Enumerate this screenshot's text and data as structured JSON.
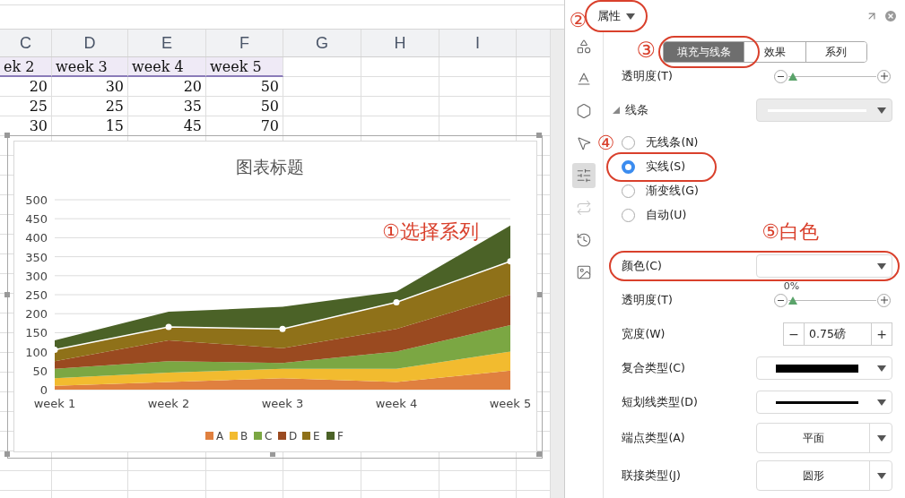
{
  "sheet": {
    "columns": [
      {
        "label": "C"
      },
      {
        "label": "D"
      },
      {
        "label": "E"
      },
      {
        "label": "F"
      },
      {
        "label": "G"
      },
      {
        "label": "H"
      },
      {
        "label": "I"
      }
    ],
    "rows": [
      {
        "kind": "text",
        "selected": true,
        "cells": [
          "ek 2",
          "week 3",
          "week 4",
          "week 5"
        ]
      },
      {
        "kind": "number",
        "selected": false,
        "cells": [
          "20",
          "30",
          "20",
          "50"
        ]
      },
      {
        "kind": "number",
        "selected": false,
        "cells": [
          "25",
          "25",
          "35",
          "50"
        ]
      },
      {
        "kind": "number",
        "selected": false,
        "cells": [
          "30",
          "15",
          "45",
          "70"
        ]
      }
    ]
  },
  "chart": {
    "chart_data": {
      "type": "area",
      "stacked": true,
      "title": "图表标题",
      "categories": [
        "week 1",
        "week 2",
        "week 3",
        "week 4",
        "week 5"
      ],
      "series": [
        {
          "name": "A",
          "color": "#e0803f",
          "values": [
            10,
            20,
            30,
            20,
            50
          ]
        },
        {
          "name": "B",
          "color": "#f2bb2f",
          "values": [
            20,
            25,
            25,
            35,
            50
          ]
        },
        {
          "name": "C",
          "color": "#7ba743",
          "values": [
            25,
            30,
            15,
            45,
            70
          ]
        },
        {
          "name": "D",
          "color": "#9a4a20",
          "values": [
            20,
            55,
            39,
            60,
            80
          ]
        },
        {
          "name": "E",
          "color": "#8f7119",
          "values": [
            30,
            35,
            51,
            70,
            88
          ]
        },
        {
          "name": "F",
          "color": "#4b6227",
          "values": [
            25,
            40,
            58,
            28,
            94
          ]
        }
      ],
      "ylim": [
        0,
        500
      ],
      "yticks": [
        0,
        50,
        100,
        150,
        200,
        250,
        300,
        350,
        400,
        450,
        500
      ],
      "grid": true,
      "legend": true,
      "annotations": [
        {
          "text": "①选择系列"
        }
      ]
    },
    "series_states": [
      {
        "selected": false
      },
      {
        "selected": false
      },
      {
        "selected": false
      },
      {
        "selected": false
      },
      {
        "selected": true
      },
      {
        "selected": false
      }
    ]
  },
  "panel": {
    "title": "属性",
    "title_highlighted": true,
    "title_callout": "②",
    "side_icons": [
      {
        "kind": "shapes",
        "selected": false,
        "disabled": false
      },
      {
        "kind": "text",
        "selected": false,
        "disabled": false
      },
      {
        "kind": "effects",
        "selected": false,
        "disabled": false
      },
      {
        "kind": "pointer",
        "selected": false,
        "disabled": false
      },
      {
        "kind": "sliders",
        "selected": true,
        "disabled": false
      },
      {
        "kind": "swap",
        "selected": false,
        "disabled": true
      },
      {
        "kind": "history",
        "selected": false,
        "disabled": false
      },
      {
        "kind": "image",
        "selected": false,
        "disabled": false
      }
    ],
    "tabs": [
      {
        "label": "填充与线条",
        "selected": true
      },
      {
        "label": "效果",
        "selected": false
      },
      {
        "label": "系列",
        "selected": false
      }
    ],
    "tabs_highlighted": true,
    "tabs_callout": "③",
    "top_transparency": {
      "label": "透明度(T)",
      "level": 0
    },
    "line_section": {
      "label": "线条",
      "expanded": true
    },
    "line_types": [
      {
        "label": "无线条(N)",
        "selected": false,
        "highlighted": false
      },
      {
        "label": "实线(S)",
        "selected": true,
        "highlighted": true,
        "callout": "④"
      },
      {
        "label": "渐变线(G)",
        "selected": false,
        "highlighted": false
      },
      {
        "label": "自动(U)",
        "selected": false,
        "highlighted": false
      }
    ],
    "properties": [
      {
        "kind": "color",
        "label": "颜色(C)",
        "highlighted": true,
        "callout": "⑤白色"
      },
      {
        "kind": "slider",
        "label": "透明度(T)",
        "reading": "0%",
        "level": 0
      },
      {
        "kind": "spinner",
        "label": "宽度(W)",
        "minus": "−",
        "value": "0.75磅",
        "plus": "+"
      },
      {
        "kind": "compound",
        "label": "复合类型(C)"
      },
      {
        "kind": "dash",
        "label": "短划线类型(D)"
      },
      {
        "kind": "choice",
        "label": "端点类型(A)",
        "value": "平面"
      },
      {
        "kind": "choice",
        "label": "联接类型(J)",
        "value": "圆形"
      }
    ]
  }
}
